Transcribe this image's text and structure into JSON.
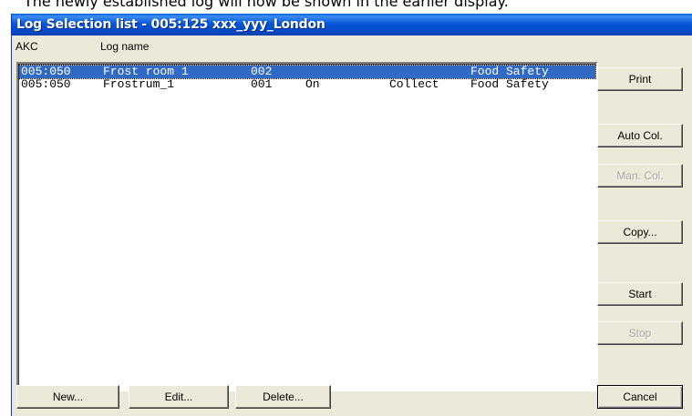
{
  "caption": "The newly established log will now be shown in the earlier display.",
  "window": {
    "title": "Log Selection list - 005:125  xxx_yyy_London"
  },
  "columns": {
    "akc": "AKC",
    "log_name": "Log name"
  },
  "rows": [
    {
      "akc": "005:050",
      "name": "Frost room 1",
      "num": "002",
      "state": "",
      "collect": "",
      "category": "Food Safety",
      "selected": true
    },
    {
      "akc": "005:050",
      "name": "Frostrum_1",
      "num": "001",
      "state": "On",
      "collect": "Collect",
      "category": "Food Safety",
      "selected": false
    }
  ],
  "buttons": {
    "print": "Print",
    "auto_col": "Auto Col.",
    "man_col": "Man. Col.",
    "copy": "Copy...",
    "start": "Start",
    "stop": "Stop",
    "new": "New...",
    "edit": "Edit...",
    "delete": "Delete...",
    "cancel": "Cancel"
  }
}
